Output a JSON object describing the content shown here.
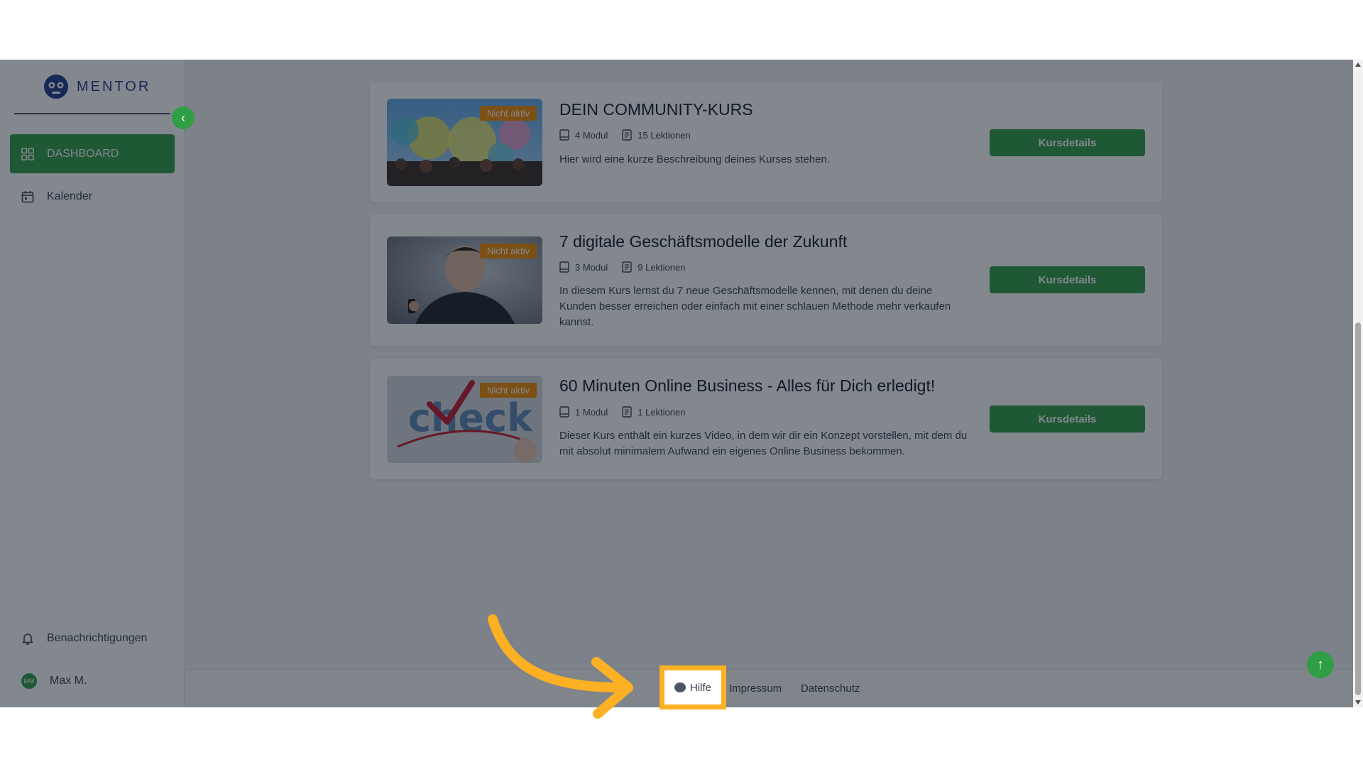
{
  "app": {
    "logo_text": "MENTOR"
  },
  "sidebar": {
    "items": [
      {
        "label": "DASHBOARD",
        "icon": "grid-icon",
        "active": true
      },
      {
        "label": "Kalender",
        "icon": "calendar-icon",
        "active": false
      }
    ],
    "bottom": [
      {
        "label": "Benachrichtigungen",
        "icon": "bell-icon"
      },
      {
        "label": "Max M.",
        "avatar_initials": "MM"
      }
    ]
  },
  "courses": [
    {
      "title": "DEIN COMMUNITY-KURS",
      "badge": "Nicht aktiv",
      "modules": "4 Modul",
      "lessons": "15 Lektionen",
      "description": "Hier wird eine kurze Beschreibung deines Kurses stehen.",
      "button": "Kursdetails"
    },
    {
      "title": "7 digitale Geschäftsmodelle der Zukunft",
      "badge": "Nicht aktiv",
      "modules": "3 Modul",
      "lessons": "9 Lektionen",
      "description": "In diesem Kurs lernst du 7 neue Geschäftsmodelle kennen, mit denen du deine Kunden besser erreichen oder einfach mit einer schlauen Methode mehr verkaufen kannst.",
      "button": "Kursdetails"
    },
    {
      "title": "60 Minuten Online Business - Alles für Dich erledigt!",
      "badge": "Nicht aktiv",
      "modules": "1 Modul",
      "lessons": "1 Lektionen",
      "description": "Dieser Kurs enthält ein kurzes Video, in dem wir dir ein Konzept vorstellen, mit dem du mit absolut minimalem Aufwand ein eigenes Online Business bekommen.",
      "button": "Kursdetails"
    }
  ],
  "footer": {
    "help": "Hilfe",
    "imprint": "Impressum",
    "privacy": "Datenschutz"
  },
  "colors": {
    "accent": "#2f9e44",
    "badge": "#f08c00",
    "highlight": "#fcb023",
    "logo": "#1e3a8a"
  }
}
